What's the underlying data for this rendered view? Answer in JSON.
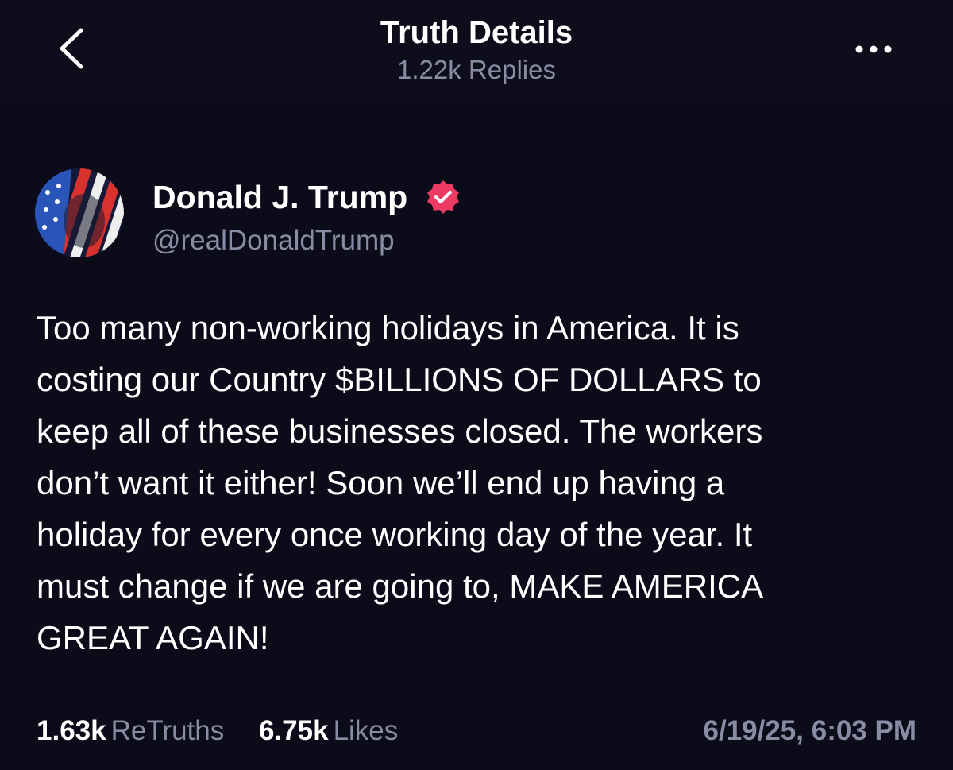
{
  "header": {
    "title": "Truth Details",
    "replies": "1.22k Replies",
    "back_icon": "chevron-left-icon",
    "more_icon": "more-horizontal-icon"
  },
  "post": {
    "author": {
      "name": "Donald J. Trump",
      "handle": "@realDonaldTrump",
      "verified": true,
      "verified_color": "#ee3b64"
    },
    "body_lines": [
      "Too many non-working holidays in America. It is",
      "costing our Country $BILLIONS OF DOLLARS to",
      "keep all of these businesses closed. The workers",
      "don’t want it either! Soon we’ll end up having a",
      "holiday for every once working day of the year. It",
      "must change if we are going to, MAKE AMERICA",
      "GREAT AGAIN!"
    ],
    "stats": {
      "retruths_count": "1.63k",
      "retruths_label": "ReTruths",
      "likes_count": "6.75k",
      "likes_label": "Likes"
    },
    "timestamp": "6/19/25, 6:03 PM"
  },
  "colors": {
    "background": "#0c0b1a",
    "secondary_text": "#8a8ca3",
    "primary_text": "#ffffff"
  }
}
